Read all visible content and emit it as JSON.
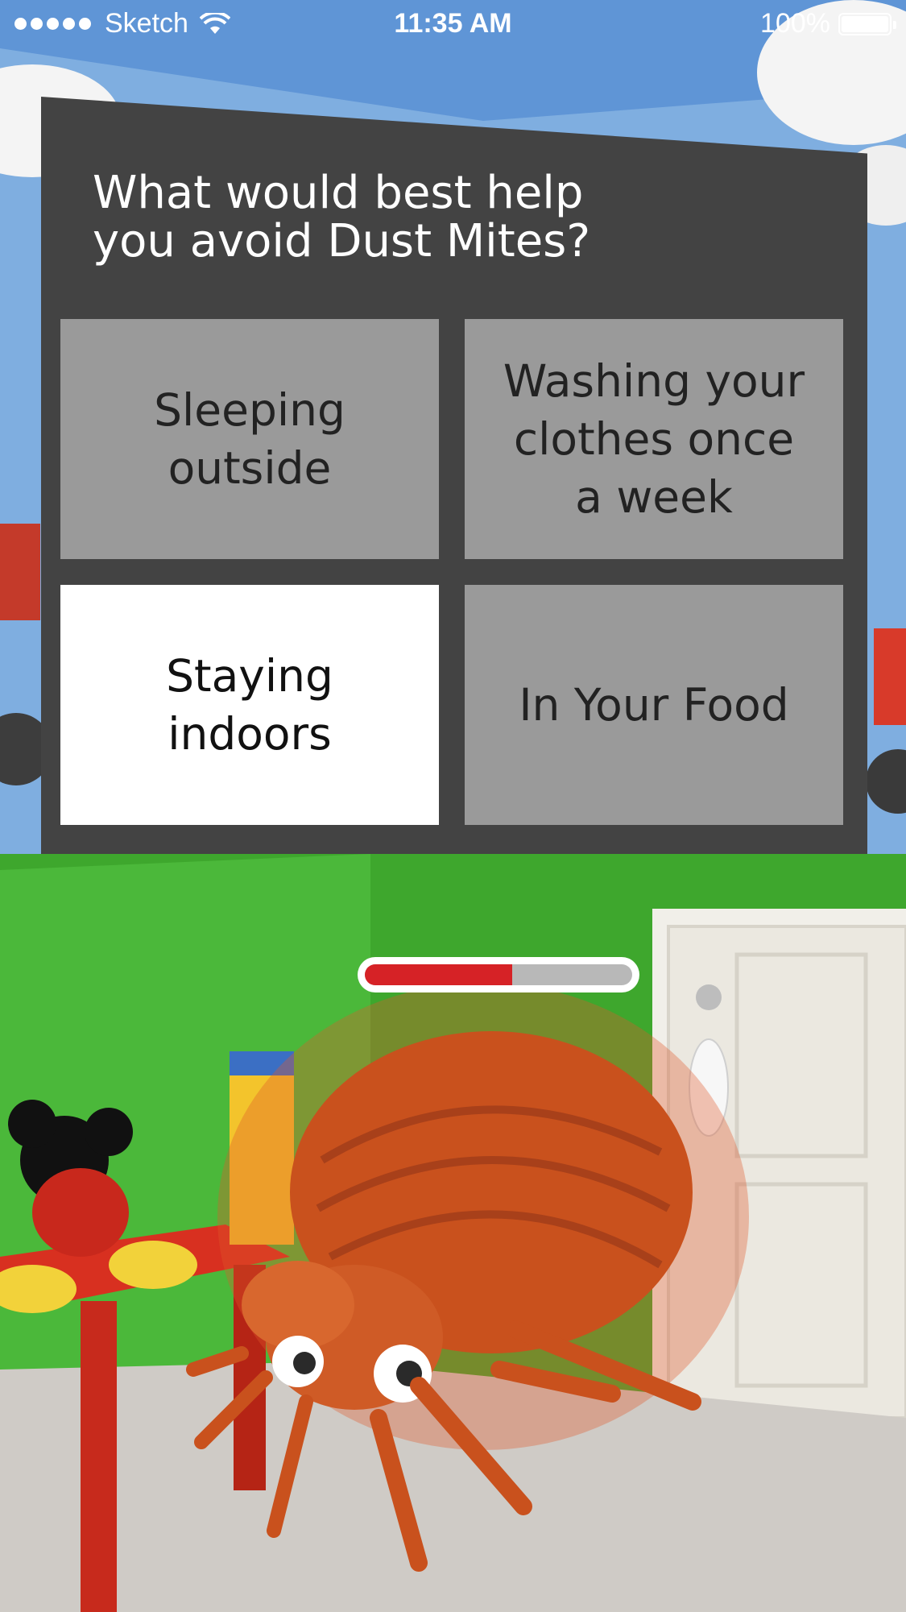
{
  "status_bar": {
    "carrier": "Sketch",
    "time": "11:35 AM",
    "battery": "100%"
  },
  "quiz": {
    "question": "What would best help\nyou avoid Dust Mites?",
    "answers": [
      {
        "label": "Sleeping\noutside",
        "selected": false
      },
      {
        "label": "Washing your\nclothes once\na week",
        "selected": false
      },
      {
        "label": "Staying\nindoors",
        "selected": true
      },
      {
        "label": "In Your Food",
        "selected": false
      }
    ]
  },
  "progress": {
    "fraction": 0.55,
    "fill_color": "#d62226",
    "track_color": "#b8b8b8"
  },
  "icons": [
    "signal-dots-icon",
    "wifi-icon",
    "battery-icon",
    "dust-mite-character",
    "bedroom-background"
  ]
}
